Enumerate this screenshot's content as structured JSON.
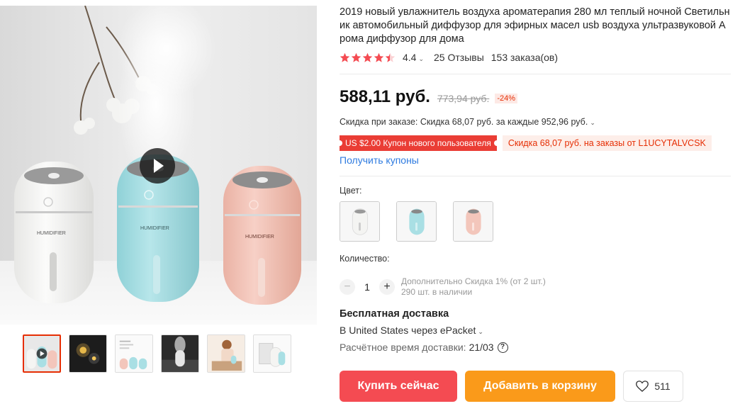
{
  "product": {
    "title": "2019 новый увлажнитель воздуха ароматерапия 280 мл теплый ночной Светильник автомобильный диффузор для эфирных масел usb воздуха ультразвуковой Арома диффузор для дома",
    "image_label": "HUMIDIFIER"
  },
  "rating": {
    "value": 4.4,
    "value_text": "4.4",
    "reviews": "25 Отзывы",
    "orders": "153 заказа(ов)"
  },
  "price": {
    "current": "588,11 руб.",
    "old": "773,94 руб.",
    "discount": "-24%"
  },
  "store_discount": {
    "text": "Скидка при заказе: Скидка 68,07 руб. за каждые 952,96 руб."
  },
  "coupons": {
    "new_user": "US $2.00 Купон нового пользователя",
    "code_discount": "Скидка 68,07 руб. на заказы от L1UCYTALVCSK",
    "get_link": "Получить купоны"
  },
  "color": {
    "label": "Цвет:",
    "options": [
      {
        "name": "white",
        "hex": "#f4f4f2"
      },
      {
        "name": "blue",
        "hex": "#a9dfe4"
      },
      {
        "name": "pink",
        "hex": "#f3c6bb"
      }
    ]
  },
  "quantity": {
    "label": "Количество:",
    "value": "1",
    "minus": "−",
    "plus": "+",
    "extra_discount": "Дополнительно Скидка 1% (от 2 шт.)",
    "stock": "290 шт. в наличии"
  },
  "shipping": {
    "title": "Бесплатная доставка",
    "destination": "В United States через ePacket",
    "estimate_label": "Расчётное время доставки:",
    "estimate_date": "21/03",
    "help_icon": "?"
  },
  "actions": {
    "buy_now": "Купить сейчас",
    "add_to_cart": "Добавить в корзину",
    "wishlist_count": "511"
  },
  "colors": {
    "accent_red": "#f44b52",
    "accent_orange": "#fa9a1a",
    "star": "#f44b52",
    "link": "#2e7be0"
  },
  "icons": {
    "play": "play-icon",
    "star": "star-icon",
    "heart": "heart-icon",
    "chevron": "chevron-down-icon",
    "help": "question-circle-icon"
  }
}
